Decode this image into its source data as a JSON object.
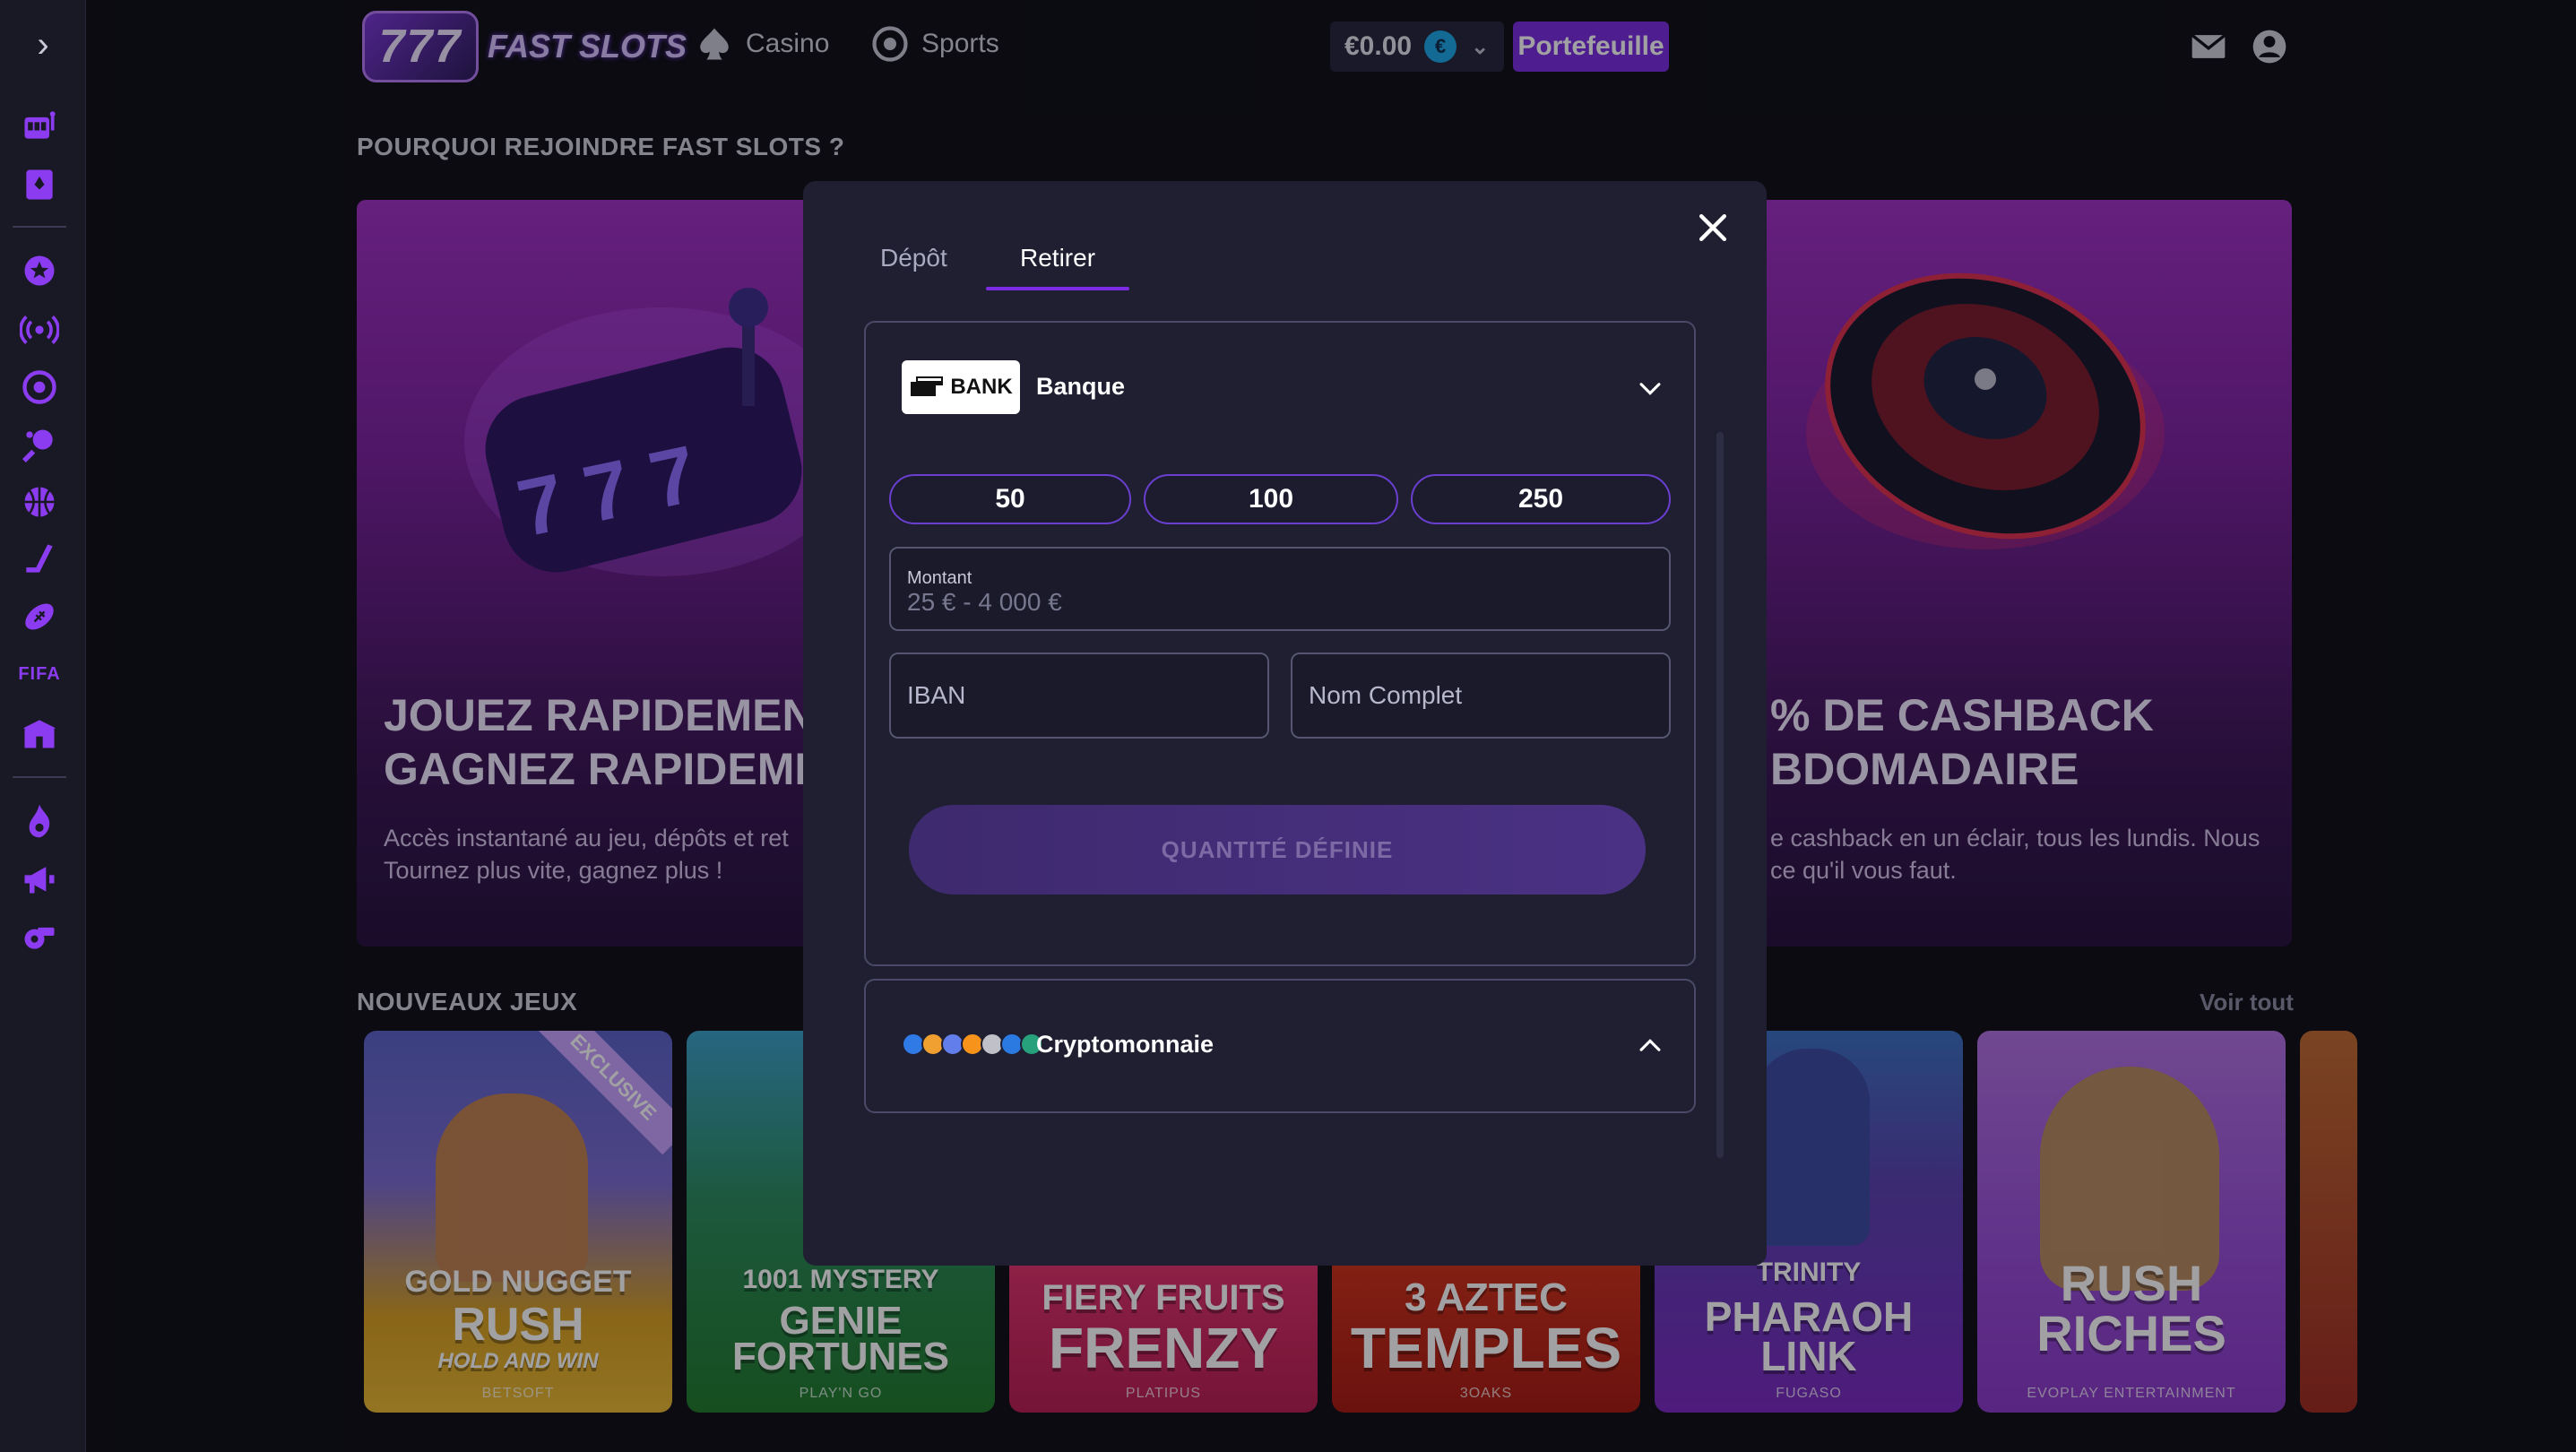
{
  "header": {
    "logo_badge": "777",
    "logo_text": "FAST SLOTS",
    "nav_casino": "Casino",
    "nav_sports": "Sports",
    "balance": "€0.00",
    "currency_symbol": "€",
    "wallet_button": "Portefeuille"
  },
  "sidebar": {
    "fifa_label": "FIFA"
  },
  "background": {
    "why_join_title": "POURQUOI REJOINDRE FAST SLOTS ?",
    "promo_left_title_1": "JOUEZ RAPIDEMENT,",
    "promo_left_title_2": "GAGNEZ RAPIDEMENT",
    "promo_left_text_1": "Accès instantané au jeu, dépôts et ret",
    "promo_left_text_2": "Tournez plus vite, gagnez plus !",
    "promo_right_title_1": "% DE CASHBACK",
    "promo_right_title_2": "BDOMADAIRE",
    "promo_right_text_1": "e cashback en un éclair, tous les lundis. Nous",
    "promo_right_text_2": "ce qu'il vous faut.",
    "new_games_title": "NOUVEAUX JEUX",
    "see_all": "Voir tout",
    "games": [
      {
        "title_1": "GOLD NUGGET",
        "title_2": "RUSH",
        "title_3": "HOLD AND WIN",
        "provider": "BETSOFT",
        "badge": "EXCLUSIVE"
      },
      {
        "title_1": "1001 MYSTERY",
        "title_2": "GENIE",
        "title_3": "FORTUNES",
        "provider": "PLAY'N GO"
      },
      {
        "title_1": "FIERY FRUITS",
        "title_2": "FRENZY",
        "provider": "PLATIPUS"
      },
      {
        "title_1": "3 AZTEC",
        "title_2": "TEMPLES",
        "provider": "3OAKS"
      },
      {
        "title_1": "TRINITY",
        "title_2": "PHARAOH",
        "title_3": "LINK",
        "provider": "FUGASO"
      },
      {
        "title_1": "RUSH RICHES",
        "provider": "EVOPLAY ENTERTAINMENT"
      }
    ]
  },
  "modal": {
    "tabs": [
      {
        "label": "Dépôt"
      },
      {
        "label": "Retirer"
      }
    ],
    "active_tab": "Retirer",
    "bank": {
      "logo_text": "BANK",
      "name": "Banque",
      "quick_amounts": [
        "50",
        "100",
        "250"
      ],
      "amount_label": "Montant",
      "amount_placeholder": "25 € - 4 000 €",
      "iban_placeholder": "IBAN",
      "fullname_placeholder": "Nom Complet",
      "submit_label": "QUANTITÉ DÉFINIE"
    },
    "crypto": {
      "name": "Cryptomonnaie"
    }
  },
  "colors": {
    "accent": "#7a2be0",
    "background": "#0d0d14",
    "modal": "#1f1f31",
    "sidebar_icons": "#8c3cf0"
  }
}
